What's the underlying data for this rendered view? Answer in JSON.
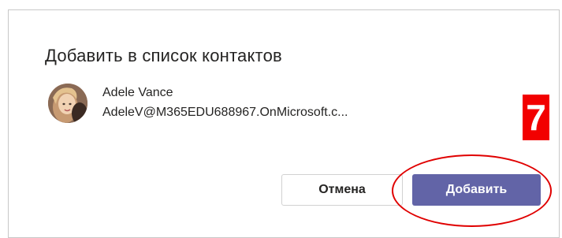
{
  "dialog": {
    "title": "Добавить в список контактов"
  },
  "contact": {
    "name": "Adele Vance",
    "email": "AdeleV@M365EDU688967.OnMicrosoft.c...",
    "avatar_icon": "user-avatar-photo"
  },
  "annotation": {
    "step_number": "7",
    "step_color": "#f20000",
    "highlight_color": "#e00000"
  },
  "buttons": {
    "cancel_label": "Отмена",
    "add_label": "Добавить",
    "add_color": "#6264a7"
  }
}
